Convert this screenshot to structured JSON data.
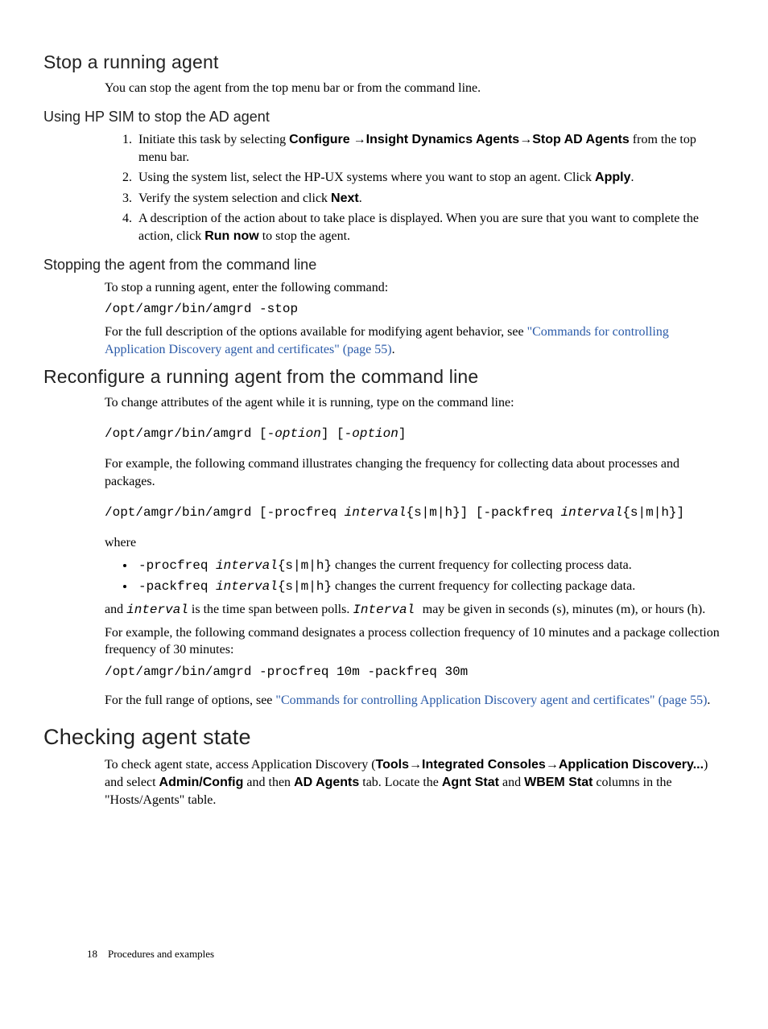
{
  "stop_agent": {
    "title": "Stop a running agent",
    "intro": "You can stop the agent from the top menu bar or from the command line.",
    "sim": {
      "title": "Using HP SIM to stop the AD agent",
      "step1_pre": "Initiate this task by selecting ",
      "configure": "Configure",
      "arrow": " →",
      "ida": "Insight Dynamics Agents",
      "arrow2": "→",
      "stop_ad": "Stop AD Agents",
      "step1_post": " from the top menu bar.",
      "step2_pre": "Using the system list, select the HP-UX systems where you want to stop an agent. Click ",
      "apply": "Apply",
      "step2_post": ".",
      "step3_pre": "Verify the system selection and click ",
      "next": "Next",
      "step3_post": ".",
      "step4_pre": "A description of the action about to take place is displayed. When you are sure that you want to complete the action, click ",
      "run_now": "Run now",
      "step4_post": " to stop the agent."
    },
    "cmd": {
      "title": "Stopping the agent from the command line",
      "intro": "To stop a running agent, enter the following command:",
      "command": "/opt/amgr/bin/amgrd -stop",
      "full_pre": "For the full description of the options available for modifying agent behavior, see ",
      "link": "\"Commands for controlling Application Discovery agent and certificates\" (page 55)",
      "full_post": "."
    }
  },
  "reconfigure": {
    "title": "Reconfigure a running agent from the command line",
    "intro": "To change attributes of the agent while it is running, type on the command line:",
    "syntax_pre": " /opt/amgr/bin/amgrd [-",
    "syntax_opt": "option",
    "syntax_mid": "] [-",
    "syntax_post": "]",
    "example_intro": "For example, the following command illustrates changing the frequency for collecting data about processes and packages.",
    "example_cmd_pre": " /opt/amgr/bin/amgrd [-procfreq ",
    "interval": "interval",
    "example_cmd_mid1": "{s|m|h}] [-packfreq ",
    "example_cmd_post": "{s|m|h}]",
    "where": "where",
    "procfreq_code_pre": "-procfreq ",
    "procfreq_code_post": "{s|m|h}",
    "procfreq_desc": "  changes the current frequency for collecting process data.",
    "packfreq_code_pre": "-packfreq ",
    "packfreq_code_post": "{s|m|h}",
    "packfreq_desc": "  changes the current frequency for collecting package data.",
    "and_interval_pre": "and ",
    "and_interval_mid": " is the time span between polls. ",
    "and_interval_mid2": "Interval ",
    "and_interval_post": " may be given in seconds (s), minutes (m), or hours (h).",
    "example2_intro": "For example, the following command designates a process collection frequency of 10 minutes and a package collection frequency of 30 minutes:",
    "example2_cmd": "/opt/amgr/bin/amgrd -procfreq 10m -packfreq 30m",
    "full_pre": "For the full range of options, see ",
    "link": "\"Commands for controlling Application Discovery agent and certificates\" (page 55)",
    "full_post": "."
  },
  "checking": {
    "title": "Checking agent state",
    "pre": "To check agent state, access Application Discovery (",
    "tools": "Tools",
    "arrow": "→",
    "ic": "Integrated Consoles",
    "ad": "Application Discovery...",
    "mid1": ") and select ",
    "admin": "Admin/Config",
    "mid2": " and then ",
    "adagents": "AD Agents",
    "mid3": " tab. Locate the ",
    "agnt": "Agnt Stat",
    "mid4": " and ",
    "wbem": "WBEM Stat",
    "post": " columns in the \"Hosts/Agents\" table."
  },
  "footer": {
    "page": "18",
    "section": "Procedures and examples"
  }
}
